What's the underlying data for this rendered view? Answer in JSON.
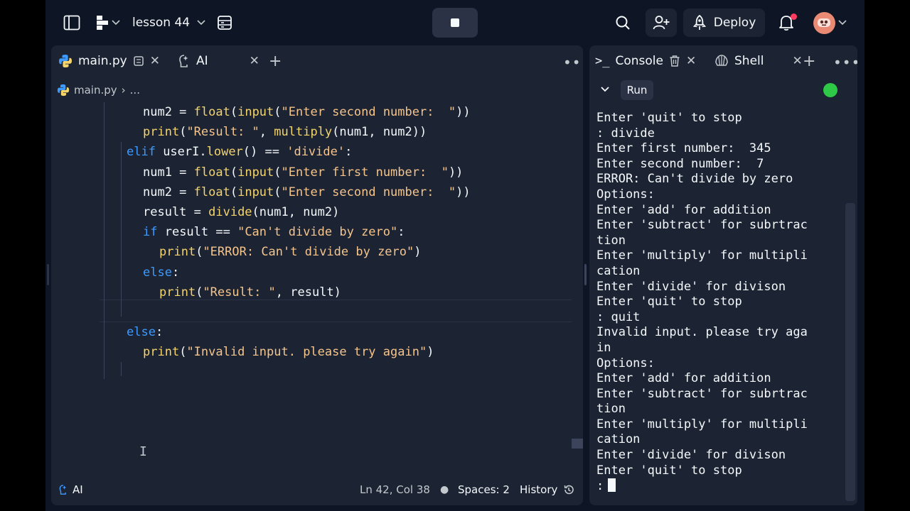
{
  "topbar": {
    "repl_name": "lesson 44",
    "deploy_label": "Deploy"
  },
  "editor": {
    "tabs": [
      {
        "label": "main.py"
      },
      {
        "label": "AI"
      }
    ],
    "breadcrumb": {
      "file": "main.py",
      "rest": "..."
    },
    "code_lines": [
      [
        {
          "t": "num2 = "
        },
        {
          "t": "float",
          "c": "fn"
        },
        {
          "t": "("
        },
        {
          "t": "input",
          "c": "fn"
        },
        {
          "t": "("
        },
        {
          "t": "\"Enter second number:  \"",
          "c": "str"
        },
        {
          "t": "))"
        }
      ],
      [
        {
          "t": "print",
          "c": "fn"
        },
        {
          "t": "("
        },
        {
          "t": "\"Result: \"",
          "c": "str"
        },
        {
          "t": ", "
        },
        {
          "t": "multiply",
          "c": "fn"
        },
        {
          "t": "(num1, num2))"
        }
      ],
      [
        {
          "t": "elif ",
          "c": "kw"
        },
        {
          "t": "userI."
        },
        {
          "t": "lower",
          "c": "fn"
        },
        {
          "t": "() == "
        },
        {
          "t": "'divide'",
          "c": "str"
        },
        {
          "t": ":"
        }
      ],
      [
        {
          "t": "num1 = "
        },
        {
          "t": "float",
          "c": "fn"
        },
        {
          "t": "("
        },
        {
          "t": "input",
          "c": "fn"
        },
        {
          "t": "("
        },
        {
          "t": "\"Enter first number:  \"",
          "c": "str"
        },
        {
          "t": "))"
        }
      ],
      [
        {
          "t": "num2 = "
        },
        {
          "t": "float",
          "c": "fn"
        },
        {
          "t": "("
        },
        {
          "t": "input",
          "c": "fn"
        },
        {
          "t": "("
        },
        {
          "t": "\"Enter second number:  \"",
          "c": "str"
        },
        {
          "t": "))"
        }
      ],
      [
        {
          "t": "result = "
        },
        {
          "t": "divide",
          "c": "fn"
        },
        {
          "t": "(num1, num2)"
        }
      ],
      [
        {
          "t": "if ",
          "c": "kw"
        },
        {
          "t": "result == "
        },
        {
          "t": "\"Can't divide by zero\"",
          "c": "str"
        },
        {
          "t": ":"
        }
      ],
      [
        {
          "t": "print",
          "c": "fn"
        },
        {
          "t": "("
        },
        {
          "t": "\"ERROR: Can't divide by zero\"",
          "c": "str"
        },
        {
          "t": ")"
        }
      ],
      [
        {
          "t": "else",
          "c": "kw"
        },
        {
          "t": ":"
        }
      ],
      [
        {
          "t": "print",
          "c": "fn"
        },
        {
          "t": "("
        },
        {
          "t": "\"Result: \"",
          "c": "str"
        },
        {
          "t": ", result)"
        }
      ],
      [],
      [
        {
          "t": "else",
          "c": "kw"
        },
        {
          "t": ":"
        }
      ],
      [
        {
          "t": "print",
          "c": "fn"
        },
        {
          "t": "("
        },
        {
          "t": "\"Invalid input. please try again\"",
          "c": "str"
        },
        {
          "t": ")"
        }
      ],
      []
    ],
    "status": {
      "ai_label": "AI",
      "position": "Ln 42, Col 38",
      "spaces": "Spaces: 2",
      "history": "History"
    }
  },
  "console": {
    "tabs": [
      {
        "label": "Console"
      },
      {
        "label": "Shell"
      }
    ],
    "run_label": "Run",
    "lines": [
      "Enter 'quit' to stop",
      ": divide",
      "Enter first number:  345",
      "Enter second number:  7",
      "ERROR: Can't divide by zero",
      "Options:",
      "Enter 'add' for addition",
      "Enter 'subtract' for subrtrac",
      "tion",
      "Enter 'multiply' for multipli",
      "cation",
      "Enter 'divide' for divison",
      "Enter 'quit' to stop",
      ": quit",
      "Invalid input. please try aga",
      "in",
      "Options:",
      "Enter 'add' for addition",
      "Enter 'subtract' for subrtrac",
      "tion",
      "Enter 'multiply' for multipli",
      "cation",
      "Enter 'divide' for divison",
      "Enter 'quit' to stop"
    ],
    "prompt": ":"
  },
  "colors": {
    "background": "#0e1525",
    "panel": "#1c2333",
    "keyword": "#3d9bff",
    "function": "#f5d46a",
    "string": "#f5c58b",
    "running_indicator": "#2ec946",
    "notification_dot": "#ff3c5f"
  },
  "icons": {
    "sidebar_toggle": "sidebar-icon",
    "logo": "replit-logo-icon",
    "files": "file-browser-icon",
    "search": "search-icon",
    "invite": "add-user-icon",
    "deploy": "deploy-icon",
    "notifications": "bell-icon",
    "python": "python-icon",
    "console": "terminal-icon",
    "shell": "shell-icon"
  }
}
